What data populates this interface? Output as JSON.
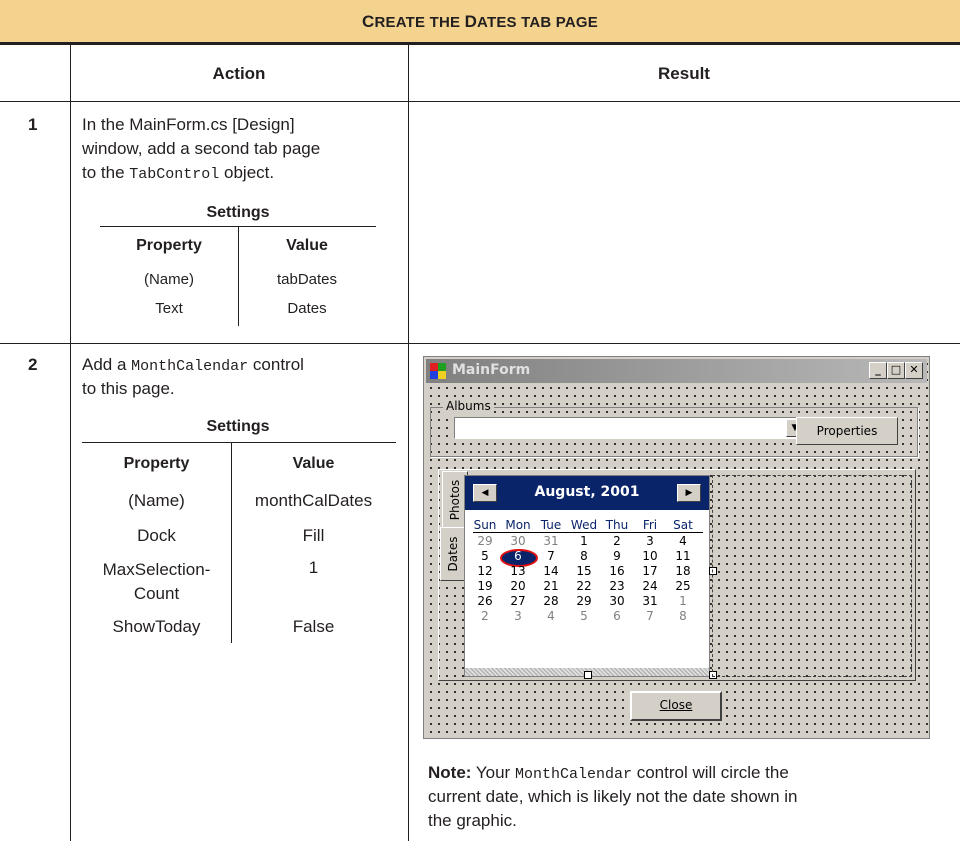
{
  "table_title": {
    "lead_cap": "C",
    "rest_1": "REATE THE ",
    "dates_cap": "D",
    "rest_2": "ATES TAB PAGE"
  },
  "columns": {
    "action": "Action",
    "result": "Result"
  },
  "step1": {
    "number": "1",
    "line1": "In the MainForm.cs [Design]",
    "line2": "window, add a second tab page",
    "line3_code": "TabControl",
    "line3_pre": "to the ",
    "line3_post": " object.",
    "settings_title": "Settings",
    "headers": {
      "property": "Property",
      "value": "Value"
    },
    "rows": [
      {
        "property": "(Name)",
        "value": "tabDates"
      },
      {
        "property": "Text",
        "value": "Dates"
      }
    ]
  },
  "step2": {
    "number": "2",
    "line1_pre": "Add a ",
    "line1_code": "MonthCalendar",
    "line1_post": " control",
    "line2": "to this page.",
    "settings_title": "Settings",
    "headers": {
      "property": "Property",
      "value": "Value"
    },
    "rows": [
      {
        "property": "(Name)",
        "value": "monthCalDates"
      },
      {
        "property": "Dock",
        "value": "Fill"
      },
      {
        "property_l1": "MaxSelection-",
        "property_l2": "Count",
        "value": "1"
      },
      {
        "property": "ShowToday",
        "value": "False"
      }
    ]
  },
  "window": {
    "title": "MainForm",
    "groupbox_label": "Albums",
    "properties_button": "Properties",
    "close_button": "Close",
    "tabs": {
      "photos": "Photos",
      "dates": "Dates"
    },
    "calendar": {
      "month": "August, 2001",
      "days_of_week": [
        "Sun",
        "Mon",
        "Tue",
        "Wed",
        "Thu",
        "Fri",
        "Sat"
      ],
      "weeks": [
        [
          "29",
          "30",
          "31",
          "1",
          "2",
          "3",
          "4"
        ],
        [
          "5",
          "6",
          "7",
          "8",
          "9",
          "10",
          "11"
        ],
        [
          "12",
          "13",
          "14",
          "15",
          "16",
          "17",
          "18"
        ],
        [
          "19",
          "20",
          "21",
          "22",
          "23",
          "24",
          "25"
        ],
        [
          "26",
          "27",
          "28",
          "29",
          "30",
          "31",
          "1"
        ],
        [
          "2",
          "3",
          "4",
          "5",
          "6",
          "7",
          "8"
        ]
      ],
      "today": "6"
    }
  },
  "note": {
    "label": "Note:",
    "pre": " Your ",
    "code": "MonthCalendar",
    "post": " control will circle the",
    "line2": "current date, which is likely not the date shown in",
    "line3": "the graphic."
  }
}
